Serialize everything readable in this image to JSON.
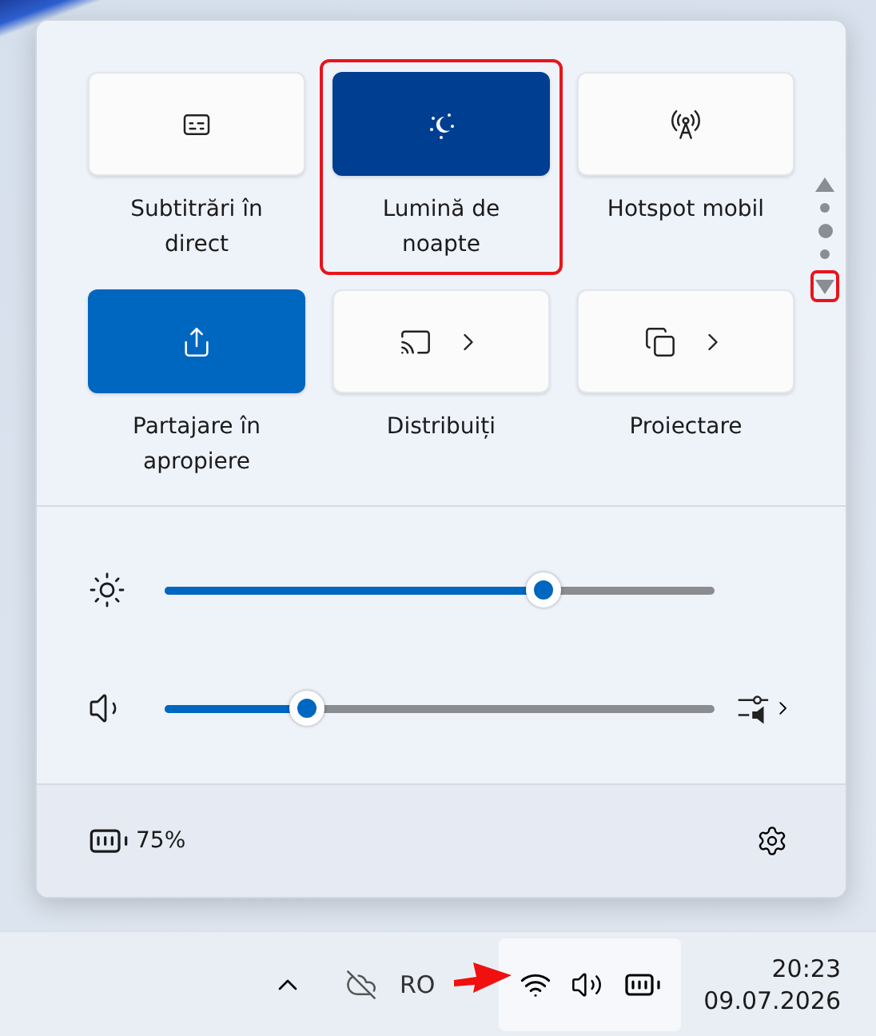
{
  "quick_settings": {
    "tiles": [
      {
        "label": "Subtitrări în direct",
        "on": false,
        "has_menu": false,
        "highlighted": false
      },
      {
        "label": "Lumină de noapte",
        "on": true,
        "has_menu": false,
        "highlighted": true
      },
      {
        "label": "Hotspot mobil",
        "on": false,
        "has_menu": false,
        "highlighted": false
      },
      {
        "label": "Partajare în apropiere",
        "on": true,
        "has_menu": false,
        "highlighted": false
      },
      {
        "label": "Distribuiți",
        "on": false,
        "has_menu": true,
        "highlighted": false
      },
      {
        "label": "Proiectare",
        "on": false,
        "has_menu": true,
        "highlighted": false
      }
    ],
    "pager": {
      "pages": [
        {
          "selected": false
        },
        {
          "selected": true
        },
        {
          "selected": false
        }
      ],
      "down_highlighted": true
    },
    "sliders": [
      {
        "kind": "brightness",
        "level": 0.69
      },
      {
        "kind": "volume",
        "level": 0.26
      }
    ],
    "battery": "75%"
  },
  "taskbar": {
    "tray_text": "RO",
    "time": "20:23",
    "date": "09.07.2026",
    "annotation_arrow": true
  }
}
